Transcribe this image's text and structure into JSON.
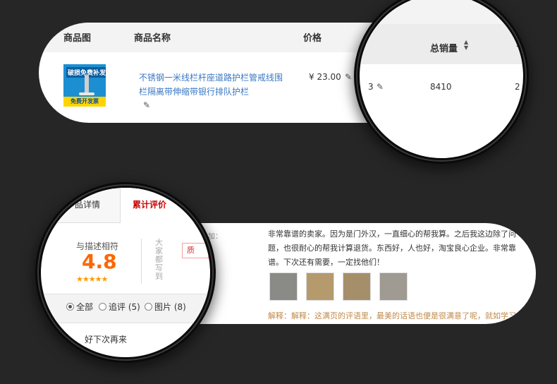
{
  "product_table": {
    "headers": {
      "image": "商品图",
      "name": "商品名称",
      "price": "价格"
    },
    "row": {
      "image_text": {
        "line1": "破损免费补发",
        "line2": "免费开发票"
      },
      "name": "不锈钢一米线栏杆座道路护栏管戒线围栏隔离带伸缩带银行排队护栏",
      "price": "¥ 23.00",
      "edit_icon": "pencil-icon"
    }
  },
  "sales_zoom": {
    "header": "总销量",
    "sort_icon": "sort-icon",
    "value": "8410",
    "partial_left": "3",
    "partial_right": "2",
    "partial_header_right": "-"
  },
  "review_panel": {
    "appended_label": "货当天追加：",
    "text": "非常靠谱的卖家。因为是门外汉，一直细心的帮我算。之后我这边除了问题，也很耐心的帮我计算退货。东西好，人也好，淘宝良心企业。非常靠谱。下次还有需要，一定找他们！",
    "photo_count_shown": 4,
    "explain": "解释：解释：这满页的评语里，最美的话语也便是很满意了呢，就如学习"
  },
  "rating_zoom": {
    "tabs": {
      "details_partial": "品详情",
      "reviews": "累计评价"
    },
    "label": "与描述相符",
    "score": "4.8",
    "stars": "★★★★★",
    "vertical_text": "大家都写到",
    "tag_partial": "质",
    "filters": [
      {
        "label": "全部",
        "selected": true
      },
      {
        "label": "追评 (5)",
        "selected": false
      },
      {
        "label": "图片 (8)",
        "selected": false
      }
    ],
    "bottom_text": "好下次再来"
  },
  "colors": {
    "background": "#262626",
    "accent_orange": "#ff6600",
    "link_blue": "#3a78c3",
    "active_tab_red": "#cc0000"
  }
}
